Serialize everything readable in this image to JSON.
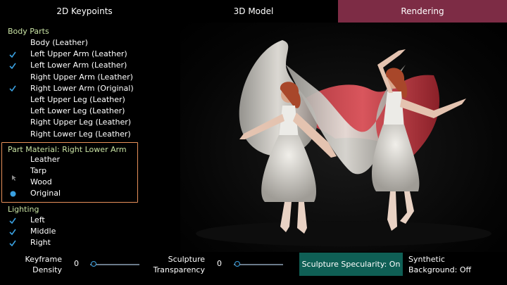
{
  "tabs": [
    {
      "label": "2D Keypoints",
      "active": false
    },
    {
      "label": "3D Model",
      "active": false
    },
    {
      "label": "Rendering",
      "active": true
    }
  ],
  "body_parts": {
    "heading": "Body Parts",
    "items": [
      {
        "label": "Body (Leather)",
        "checked": false
      },
      {
        "label": "Left Upper Arm (Leather)",
        "checked": true
      },
      {
        "label": "Left Lower Arm (Leather)",
        "checked": true
      },
      {
        "label": "Right Upper Arm (Leather)",
        "checked": false
      },
      {
        "label": "Right Lower Arm (Original)",
        "checked": true
      },
      {
        "label": "Left Upper Leg (Leather)",
        "checked": false
      },
      {
        "label": "Left Lower Leg (Leather)",
        "checked": false
      },
      {
        "label": "Right Upper Leg (Leather)",
        "checked": false
      },
      {
        "label": "Right Lower Leg (Leather)",
        "checked": false
      }
    ]
  },
  "material": {
    "heading": "Part Material: Right Lower Arm",
    "options": [
      {
        "label": "Leather",
        "selected": false
      },
      {
        "label": "Tarp",
        "selected": false
      },
      {
        "label": "Wood",
        "selected": false
      },
      {
        "label": "Original",
        "selected": true
      }
    ]
  },
  "lighting": {
    "heading": "Lighting",
    "items": [
      {
        "label": "Left",
        "checked": true
      },
      {
        "label": "Middle",
        "checked": true
      },
      {
        "label": "Right",
        "checked": true
      }
    ]
  },
  "controls": {
    "keyframe_label_1": "Keyframe",
    "keyframe_label_2": "Density",
    "keyframe_value": "0",
    "sculpture_label_1": "Sculpture",
    "sculpture_label_2": "Transparency",
    "sculpture_value": "0",
    "specularity_label": "Sculpture Specularity: On",
    "synthetic_label_1": "Synthetic",
    "synthetic_label_2": "Background: Off"
  },
  "colors": {
    "active_tab": "#7d2c45",
    "heading": "#c9e3a4",
    "check": "#3aa0e0",
    "panel_border": "#e8915a",
    "button": "#0f5f55"
  }
}
